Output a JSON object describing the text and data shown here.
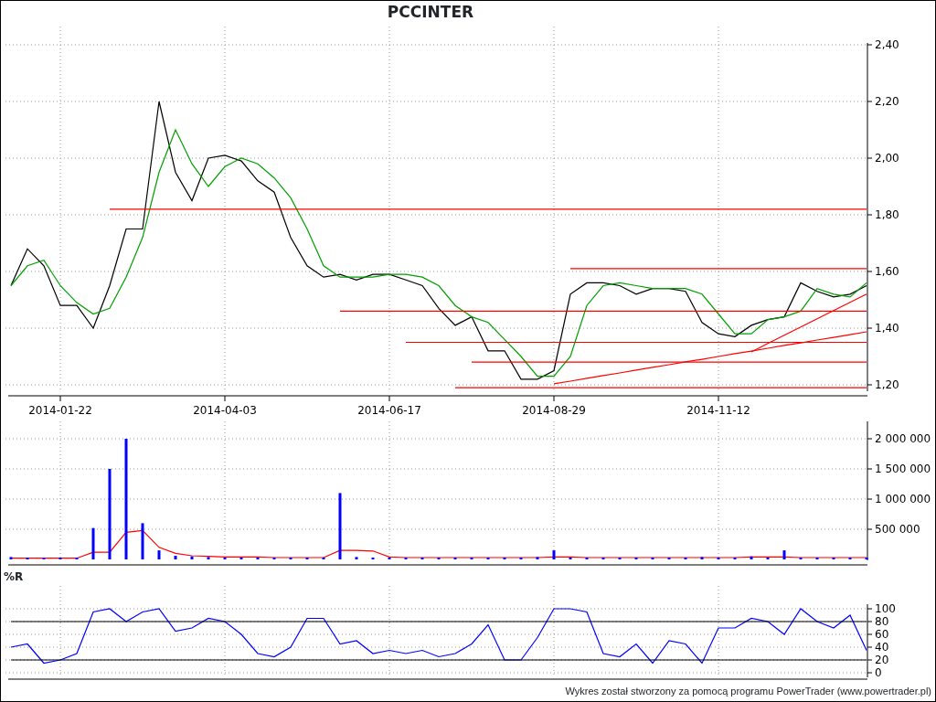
{
  "title": "PCCINTER",
  "price_chart": {
    "chart_data": {
      "type": "line",
      "grid": true,
      "ylim": [
        1.18,
        2.4
      ],
      "categories": [
        null,
        null,
        null,
        "2014-01-22",
        null,
        null,
        null,
        null,
        null,
        null,
        null,
        null,
        null,
        "2014-04-03",
        null,
        null,
        null,
        null,
        null,
        null,
        null,
        null,
        null,
        "2014-06-17",
        null,
        null,
        null,
        null,
        null,
        null,
        null,
        null,
        null,
        "2014-08-29",
        null,
        null,
        null,
        null,
        null,
        null,
        null,
        null,
        null,
        "2014-11-12",
        null,
        null,
        null,
        null,
        null,
        null,
        null,
        null,
        null
      ],
      "series": [
        {
          "color": "#000000",
          "values": [
            1.55,
            1.68,
            1.62,
            1.48,
            1.48,
            1.4,
            1.55,
            1.75,
            1.75,
            2.2,
            1.95,
            1.85,
            2.0,
            2.01,
            1.99,
            1.92,
            1.88,
            1.72,
            1.62,
            1.58,
            1.59,
            1.57,
            1.59,
            1.59,
            1.57,
            1.55,
            1.47,
            1.41,
            1.44,
            1.32,
            1.32,
            1.22,
            1.22,
            1.25,
            1.52,
            1.56,
            1.56,
            1.55,
            1.52,
            1.54,
            1.54,
            1.53,
            1.42,
            1.38,
            1.37,
            1.41,
            1.43,
            1.44,
            1.56,
            1.53,
            1.51,
            1.52,
            1.55
          ]
        },
        {
          "color": "#00a000",
          "values": [
            1.55,
            1.62,
            1.64,
            1.55,
            1.49,
            1.45,
            1.47,
            1.58,
            1.72,
            1.95,
            2.1,
            1.98,
            1.9,
            1.97,
            2.0,
            1.98,
            1.93,
            1.86,
            1.75,
            1.62,
            1.58,
            1.58,
            1.58,
            1.59,
            1.59,
            1.58,
            1.55,
            1.48,
            1.44,
            1.42,
            1.36,
            1.3,
            1.23,
            1.23,
            1.3,
            1.48,
            1.55,
            1.56,
            1.55,
            1.54,
            1.54,
            1.54,
            1.52,
            1.45,
            1.38,
            1.38,
            1.43,
            1.44,
            1.46,
            1.54,
            1.52,
            1.51,
            1.56
          ]
        },
        {
          "color": "#ff0000",
          "values": [
            null,
            null,
            null,
            null,
            null,
            null,
            1.82,
            1.82,
            1.82,
            1.82,
            1.82,
            1.82,
            1.82,
            1.82,
            1.82,
            1.82,
            1.82,
            1.82,
            1.82,
            1.82,
            1.82,
            1.82,
            1.82,
            1.82,
            1.82,
            1.82,
            1.82,
            1.82,
            1.82,
            1.82,
            1.82,
            1.82,
            1.82,
            1.82,
            1.82,
            1.82,
            1.82,
            1.82,
            1.82,
            1.82,
            1.82,
            1.82,
            1.82,
            1.82,
            1.82,
            1.82,
            1.82,
            1.82,
            1.82,
            1.82,
            1.82,
            1.82,
            1.82
          ]
        },
        {
          "color": "#ff0000",
          "values": [
            null,
            null,
            null,
            null,
            null,
            null,
            null,
            null,
            null,
            null,
            null,
            null,
            null,
            null,
            null,
            null,
            null,
            null,
            null,
            null,
            null,
            null,
            null,
            null,
            null,
            null,
            null,
            null,
            null,
            null,
            null,
            null,
            null,
            null,
            1.61,
            1.61,
            1.61,
            1.61,
            1.61,
            1.61,
            1.61,
            1.61,
            1.61,
            1.61,
            1.61,
            1.61,
            1.61,
            1.61,
            1.61,
            1.61,
            1.61,
            1.61,
            1.61
          ]
        },
        {
          "color": "#ff0000",
          "values": [
            null,
            null,
            null,
            null,
            null,
            null,
            null,
            null,
            null,
            null,
            null,
            null,
            null,
            null,
            null,
            null,
            null,
            null,
            null,
            null,
            1.46,
            1.46,
            1.46,
            1.46,
            1.46,
            1.46,
            1.46,
            1.46,
            1.46,
            1.46,
            1.46,
            1.46,
            1.46,
            1.46,
            1.46,
            1.46,
            1.46,
            1.46,
            1.46,
            1.46,
            1.46,
            1.46,
            1.46,
            1.46,
            1.46,
            1.46,
            1.46,
            1.46,
            1.46,
            1.46,
            1.46,
            1.46,
            1.46
          ]
        },
        {
          "color": "#ff0000",
          "values": [
            null,
            null,
            null,
            null,
            null,
            null,
            null,
            null,
            null,
            null,
            null,
            null,
            null,
            null,
            null,
            null,
            null,
            null,
            null,
            null,
            null,
            null,
            null,
            null,
            1.35,
            1.35,
            1.35,
            1.35,
            1.35,
            1.35,
            1.35,
            1.35,
            1.35,
            1.35,
            1.35,
            1.35,
            1.35,
            1.35,
            1.35,
            1.35,
            1.35,
            1.35,
            1.35,
            1.35,
            1.35,
            1.35,
            1.35,
            1.35,
            1.35,
            1.35,
            1.35,
            1.35,
            1.35
          ]
        },
        {
          "color": "#ff0000",
          "values": [
            null,
            null,
            null,
            null,
            null,
            null,
            null,
            null,
            null,
            null,
            null,
            null,
            null,
            null,
            null,
            null,
            null,
            null,
            null,
            null,
            null,
            null,
            null,
            null,
            null,
            null,
            null,
            null,
            1.28,
            1.28,
            1.28,
            1.28,
            1.28,
            1.28,
            1.28,
            1.28,
            1.28,
            1.28,
            1.28,
            1.28,
            1.28,
            1.28,
            1.28,
            1.28,
            1.28,
            1.28,
            1.28,
            1.28,
            1.28,
            1.28,
            1.28,
            1.28,
            1.28
          ]
        },
        {
          "color": "#ff0000",
          "values": [
            null,
            null,
            null,
            null,
            null,
            null,
            null,
            null,
            null,
            null,
            null,
            null,
            null,
            null,
            null,
            null,
            null,
            null,
            null,
            null,
            null,
            null,
            null,
            null,
            null,
            null,
            null,
            1.19,
            1.19,
            1.19,
            1.19,
            1.19,
            1.19,
            1.19,
            1.19,
            1.19,
            1.19,
            1.19,
            1.19,
            1.19,
            1.19,
            1.19,
            1.19,
            1.19,
            1.19,
            1.19,
            1.19,
            1.19,
            1.19,
            1.19,
            1.19,
            1.19,
            1.19
          ]
        },
        {
          "color": "#ff0000",
          "values": [
            null,
            null,
            null,
            null,
            null,
            null,
            null,
            null,
            null,
            null,
            null,
            null,
            null,
            null,
            null,
            null,
            null,
            null,
            null,
            null,
            null,
            null,
            null,
            null,
            null,
            null,
            null,
            null,
            null,
            null,
            null,
            null,
            null,
            1.204,
            1.213,
            1.223,
            1.233,
            1.242,
            1.252,
            1.262,
            1.271,
            1.281,
            1.29,
            1.3,
            1.31,
            1.319,
            1.329,
            1.339,
            1.348,
            1.358,
            1.367,
            1.377,
            1.387
          ]
        },
        {
          "color": "#ff0000",
          "values": [
            null,
            null,
            null,
            null,
            null,
            null,
            null,
            null,
            null,
            null,
            null,
            null,
            null,
            null,
            null,
            null,
            null,
            null,
            null,
            null,
            null,
            null,
            null,
            null,
            null,
            null,
            null,
            null,
            null,
            null,
            null,
            null,
            null,
            null,
            null,
            null,
            null,
            null,
            null,
            null,
            null,
            null,
            null,
            null,
            null,
            1.316,
            1.346,
            1.375,
            1.404,
            1.433,
            1.462,
            1.491,
            1.52
          ]
        }
      ],
      "yticks": [
        {
          "value": 1.2,
          "label": "1,20"
        },
        {
          "value": 1.4,
          "label": "1,40"
        },
        {
          "value": 1.6,
          "label": "1,60"
        },
        {
          "value": 1.8,
          "label": "1,80"
        },
        {
          "value": 2.0,
          "label": "2,00"
        },
        {
          "value": 2.2,
          "label": "2,20"
        },
        {
          "value": 2.4,
          "label": "2,40"
        }
      ]
    }
  },
  "volume_chart": {
    "chart_data": {
      "type": "bar",
      "grid": true,
      "ylim": [
        0,
        2000000
      ],
      "categories": [
        null,
        null,
        null,
        null,
        null,
        null,
        null,
        null,
        null,
        null,
        null,
        null,
        null,
        null,
        null,
        null,
        null,
        null,
        null,
        null,
        null,
        null,
        null,
        null,
        null,
        null,
        null,
        null,
        null,
        null,
        null,
        null,
        null,
        null,
        null,
        null,
        null,
        null,
        null,
        null,
        null,
        null,
        null,
        null,
        null,
        null,
        null,
        null,
        null,
        null,
        null,
        null,
        null
      ],
      "series": [
        {
          "type": "bar",
          "color": "#0000ff",
          "values": [
            40000,
            30000,
            30000,
            30000,
            30000,
            520000,
            1500000,
            2000000,
            600000,
            150000,
            60000,
            50000,
            40000,
            30000,
            30000,
            30000,
            30000,
            30000,
            30000,
            30000,
            1100000,
            40000,
            30000,
            30000,
            30000,
            30000,
            30000,
            30000,
            30000,
            30000,
            30000,
            30000,
            40000,
            150000,
            30000,
            30000,
            30000,
            30000,
            30000,
            30000,
            30000,
            30000,
            40000,
            30000,
            30000,
            50000,
            30000,
            150000,
            30000,
            30000,
            30000,
            30000,
            30000
          ]
        },
        {
          "type": "line",
          "color": "#ff0000",
          "values": [
            20000,
            20000,
            20000,
            20000,
            20000,
            120000,
            120000,
            450000,
            480000,
            200000,
            100000,
            60000,
            50000,
            40000,
            40000,
            40000,
            30000,
            30000,
            30000,
            30000,
            150000,
            150000,
            140000,
            40000,
            30000,
            30000,
            30000,
            30000,
            30000,
            30000,
            30000,
            30000,
            30000,
            40000,
            40000,
            30000,
            30000,
            30000,
            30000,
            30000,
            30000,
            30000,
            30000,
            30000,
            30000,
            40000,
            40000,
            40000,
            30000,
            30000,
            30000,
            30000,
            30000
          ]
        }
      ],
      "yticks": [
        {
          "value": 500000,
          "label": "500 000"
        },
        {
          "value": 1000000,
          "label": "1 000 000"
        },
        {
          "value": 1500000,
          "label": "1 500 000"
        },
        {
          "value": 2000000,
          "label": "2 000 000"
        }
      ]
    }
  },
  "williams_r_chart": {
    "chart_data": {
      "type": "line",
      "grid": true,
      "title": "%R",
      "ylim": [
        0,
        100
      ],
      "categories": [
        null,
        null,
        null,
        null,
        null,
        null,
        null,
        null,
        null,
        null,
        null,
        null,
        null,
        null,
        null,
        null,
        null,
        null,
        null,
        null,
        null,
        null,
        null,
        null,
        null,
        null,
        null,
        null,
        null,
        null,
        null,
        null,
        null,
        null,
        null,
        null,
        null,
        null,
        null,
        null,
        null,
        null,
        null,
        null,
        null,
        null,
        null,
        null,
        null,
        null,
        null,
        null,
        null
      ],
      "series": [
        {
          "color": "#0000ff",
          "values": [
            40,
            45,
            15,
            20,
            30,
            95,
            100,
            80,
            95,
            100,
            65,
            70,
            85,
            80,
            60,
            30,
            25,
            40,
            85,
            85,
            45,
            50,
            30,
            35,
            30,
            35,
            25,
            30,
            45,
            75,
            20,
            20,
            55,
            100,
            100,
            95,
            30,
            25,
            45,
            15,
            50,
            45,
            15,
            70,
            70,
            85,
            80,
            60,
            100,
            80,
            70,
            90,
            35
          ]
        },
        {
          "color": "#000000",
          "values": [
            20,
            20,
            20,
            20,
            20,
            20,
            20,
            20,
            20,
            20,
            20,
            20,
            20,
            20,
            20,
            20,
            20,
            20,
            20,
            20,
            20,
            20,
            20,
            20,
            20,
            20,
            20,
            20,
            20,
            20,
            20,
            20,
            20,
            20,
            20,
            20,
            20,
            20,
            20,
            20,
            20,
            20,
            20,
            20,
            20,
            20,
            20,
            20,
            20,
            20,
            20,
            20,
            20
          ]
        },
        {
          "color": "#000000",
          "values": [
            80,
            80,
            80,
            80,
            80,
            80,
            80,
            80,
            80,
            80,
            80,
            80,
            80,
            80,
            80,
            80,
            80,
            80,
            80,
            80,
            80,
            80,
            80,
            80,
            80,
            80,
            80,
            80,
            80,
            80,
            80,
            80,
            80,
            80,
            80,
            80,
            80,
            80,
            80,
            80,
            80,
            80,
            80,
            80,
            80,
            80,
            80,
            80,
            80,
            80,
            80,
            80,
            80
          ]
        }
      ],
      "yticks": [
        {
          "value": 0,
          "label": "0"
        },
        {
          "value": 20,
          "label": "20"
        },
        {
          "value": 40,
          "label": "40"
        },
        {
          "value": 60,
          "label": "60"
        },
        {
          "value": 80,
          "label": "80"
        },
        {
          "value": 100,
          "label": "100"
        }
      ]
    }
  },
  "footer": "Wykres został stworzony za pomocą programu PowerTrader (www.powertrader.pl)"
}
